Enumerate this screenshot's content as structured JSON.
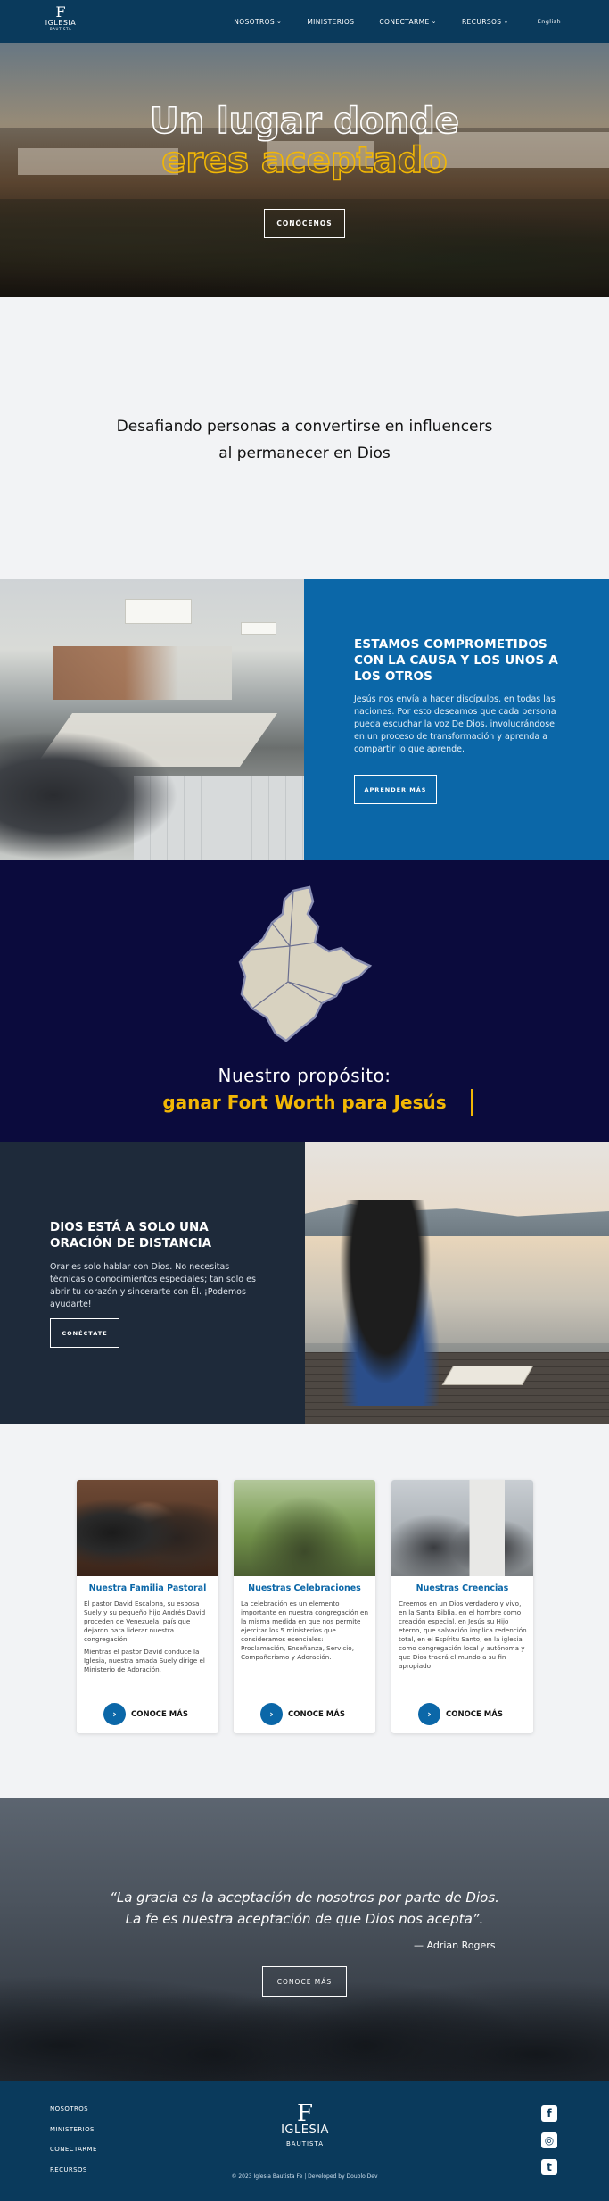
{
  "header": {
    "logo": {
      "big": "F",
      "word": "IGLESIA",
      "sub": "BAUTISTA"
    },
    "nav": [
      {
        "label": "NOSOTROS",
        "has_dropdown": true
      },
      {
        "label": "MINISTERIOS",
        "has_dropdown": false
      },
      {
        "label": "CONECTARME",
        "has_dropdown": true
      },
      {
        "label": "RECURSOS",
        "has_dropdown": true
      }
    ],
    "lang": "English"
  },
  "hero": {
    "line1": "Un lugar donde",
    "line2": "eres aceptado",
    "button": "CONÓCENOS"
  },
  "tagline": {
    "line1": "Desafiando personas a convertirse en influencers",
    "line2": "al permanecer en Dios"
  },
  "commit": {
    "title": "ESTAMOS COMPROMETIDOS CON LA CAUSA Y LOS UNOS A LOS OTROS",
    "text": "Jesús nos envía a hacer discípulos, en todas las naciones. Por esto deseamos que cada persona pueda escuchar la voz De Dios, involucrándose en un proceso de transformación y aprenda a compartir lo que aprende.",
    "button": "APRENDER MÁS"
  },
  "purpose": {
    "pre": "Nuestro propósito:",
    "main": "ganar Fort Worth para Jesús"
  },
  "prayer": {
    "title": "DIOS ESTÁ A SOLO UNA ORACIÓN DE DISTANCIA",
    "text": "Orar es solo hablar con Dios. No necesitas técnicas o conocimientos especiales; tan solo es abrir tu corazón y sincerarte con Él. ¡Podemos ayudarte!",
    "button": "CONÉCTATE"
  },
  "cards": [
    {
      "title": "Nuestra Familia Pastoral",
      "paragraphs": [
        "El pastor David Escalona, su esposa Suely y su pequeño hijo Andrés David proceden de Venezuela, país que dejaron para liderar nuestra congregación.",
        "Mientras el pastor David conduce la Iglesia, nuestra amada Suely dirige el Ministerio de Adoración."
      ],
      "more": "CONOCE MÁS"
    },
    {
      "title": "Nuestras Celebraciones",
      "paragraphs": [
        "La celebración es un elemento importante en nuestra congregación en la misma medida en que nos permite ejercitar los 5 ministerios que consideramos esenciales: Proclamación, Enseñanza, Servicio, Compañerismo y Adoración."
      ],
      "more": "CONOCE MÁS"
    },
    {
      "title": "Nuestras Creencias",
      "paragraphs": [
        "Creemos en un Dios verdadero y vivo, en la Santa Biblia, en el hombre como creación especial, en Jesús su Hijo eterno, que salvación implica redención total, en el Espíritu Santo, en la iglesia como congregación local y autónoma y que Dios traerá el mundo a su fin apropiado"
      ],
      "more": "CONOCE MÁS"
    }
  ],
  "quote": {
    "line1": "“La gracia es la aceptación de nosotros por parte de Dios.",
    "line2": "La fe es nuestra aceptación de que Dios nos acepta”.",
    "author": "— Adrian Rogers",
    "button": "CONOCE MÁS"
  },
  "footer": {
    "links": [
      "NOSOTROS",
      "MINISTERIOS",
      "CONECTARME",
      "RECURSOS"
    ],
    "copyright": "© 2023 Iglesia Bautista Fe   |   Developed by Doublo Dev",
    "social": [
      "facebook-icon",
      "instagram-icon",
      "twitter-icon"
    ]
  },
  "colors": {
    "navy_header": "#0a3a5c",
    "blue_panel": "#0b67a8",
    "dark_purpose": "#0b0b3d",
    "dark_prayer": "#1e2a3a",
    "accent_gold": "#f2b705"
  }
}
